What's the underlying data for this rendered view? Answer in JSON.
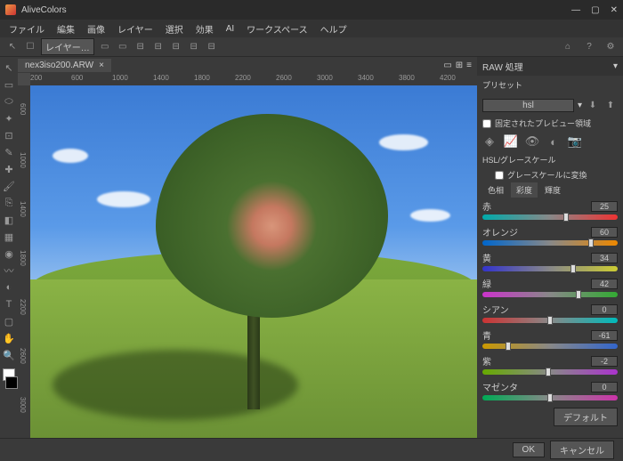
{
  "app": {
    "title": "AliveColors"
  },
  "menu": [
    "ファイル",
    "編集",
    "画像",
    "レイヤー",
    "選択",
    "効果",
    "AI",
    "ワークスペース",
    "ヘルプ"
  ],
  "optionsbar": {
    "layer_select": "レイヤー…"
  },
  "tab": {
    "filename": "nex3iso200.ARW"
  },
  "ruler_h": [
    "200",
    "600",
    "1000",
    "1400",
    "1800",
    "2200",
    "2600",
    "3000",
    "3400",
    "3800",
    "4200"
  ],
  "ruler_v": [
    "600",
    "1000",
    "1400",
    "1800",
    "2200",
    "2600",
    "3000"
  ],
  "panel": {
    "title": "RAW 処理",
    "preset_label": "プリセット",
    "preset_value": "hsl",
    "fixed_preview": "固定されたプレビュー領域",
    "hsl_label": "HSL/グレースケール",
    "grayscale": "グレースケールに変換",
    "tabs": [
      "色相",
      "彩度",
      "輝度"
    ],
    "sliders": [
      {
        "label": "赤",
        "value": "25",
        "cls": "t-red",
        "pos": 62
      },
      {
        "label": "オレンジ",
        "value": "60",
        "cls": "t-orange",
        "pos": 80
      },
      {
        "label": "黄",
        "value": "34",
        "cls": "t-yellow",
        "pos": 67
      },
      {
        "label": "緑",
        "value": "42",
        "cls": "t-green",
        "pos": 71
      },
      {
        "label": "シアン",
        "value": "0",
        "cls": "t-cyan",
        "pos": 50
      },
      {
        "label": "青",
        "value": "-61",
        "cls": "t-blue",
        "pos": 19
      },
      {
        "label": "紫",
        "value": "-2",
        "cls": "t-purple",
        "pos": 49
      },
      {
        "label": "マゼンタ",
        "value": "0",
        "cls": "t-magenta",
        "pos": 50
      }
    ],
    "default_btn": "デフォルト"
  },
  "footer": {
    "ok": "OK",
    "cancel": "キャンセル"
  }
}
